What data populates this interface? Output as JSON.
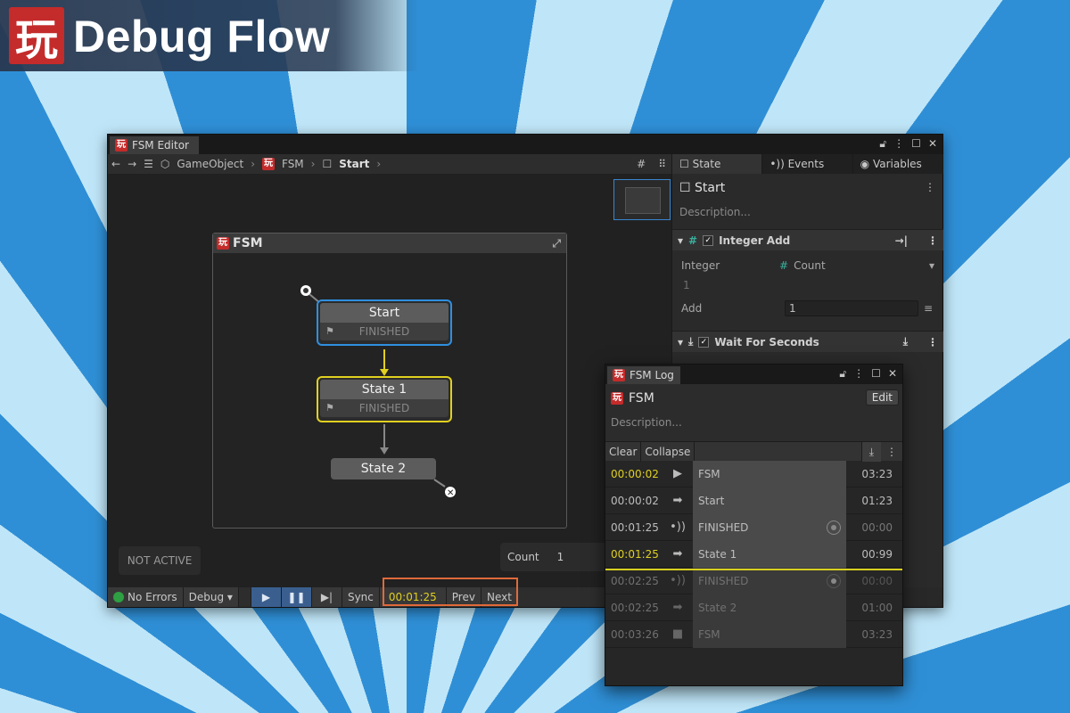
{
  "banner": {
    "logo_glyph": "玩",
    "title": "Debug Flow"
  },
  "editor": {
    "tab_title": "FSM Editor",
    "toolbar": {
      "breadcrumbs": [
        "GameObject",
        "FSM",
        "Start"
      ]
    },
    "fsm_frame": {
      "title": "FSM"
    },
    "states": {
      "start": {
        "name": "Start",
        "event": "FINISHED"
      },
      "state1": {
        "name": "State 1",
        "event": "FINISHED"
      },
      "state2": {
        "name": "State 2"
      }
    },
    "not_active_label": "NOT ACTIVE",
    "count": {
      "label": "Count",
      "value": "1"
    },
    "bottombar": {
      "no_errors": "No Errors",
      "debug": "Debug",
      "sync": "Sync",
      "time": "00:01:25",
      "prev": "Prev",
      "next": "Next"
    }
  },
  "inspector": {
    "tabs": [
      "State",
      "Events",
      "Variables"
    ],
    "state_name": "Start",
    "description_placeholder": "Description...",
    "integer_add": {
      "title": "Integer Add",
      "integer_label": "Integer",
      "integer_value": "Count",
      "integer_current": "1",
      "add_label": "Add",
      "add_value": "1"
    },
    "wait_for_seconds": {
      "title": "Wait For Seconds"
    }
  },
  "fsm_log": {
    "tab_title": "FSM Log",
    "fsm_name": "FSM",
    "edit_label": "Edit",
    "description_placeholder": "Description...",
    "clear_label": "Clear",
    "collapse_label": "Collapse",
    "rows": [
      {
        "time": "00:00:02",
        "icon": "play-icon",
        "label": "FSM",
        "dur": "03:23",
        "highlight": true
      },
      {
        "time": "00:00:02",
        "icon": "arrow-icon",
        "label": "Start",
        "dur": "01:23"
      },
      {
        "time": "00:01:25",
        "icon": "broadcast-icon",
        "label": "FINISHED",
        "dur": "00:00"
      },
      {
        "time": "00:01:25",
        "icon": "arrow-icon",
        "label": "State 1",
        "dur": "00:99",
        "highlight": true
      },
      {
        "time": "00:02:25",
        "icon": "broadcast-icon",
        "label": "FINISHED",
        "dur": "00:00"
      },
      {
        "time": "00:02:25",
        "icon": "arrow-icon",
        "label": "State 2",
        "dur": "01:00"
      },
      {
        "time": "00:03:26",
        "icon": "stop-icon",
        "label": "FSM",
        "dur": "03:23"
      }
    ]
  },
  "colors": {
    "active_state": "#2f8fe0",
    "current_state": "#e0d020",
    "highlight_time": "#e0d020",
    "time_frame": "#e06a3a"
  }
}
